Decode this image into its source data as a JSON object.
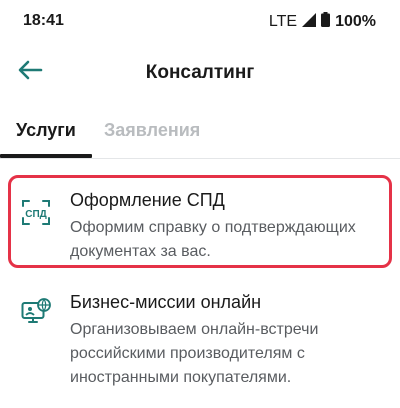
{
  "status_bar": {
    "time": "18:41",
    "network": "LTE",
    "battery": "100%"
  },
  "header": {
    "title": "Консалтинг",
    "back_icon": "arrow-left-icon"
  },
  "tabs": [
    {
      "label": "Услуги",
      "active": true
    },
    {
      "label": "Заявления",
      "active": false
    }
  ],
  "services": [
    {
      "title": "Оформление СПД",
      "description": "Оформим справку о подтверждающих документах за вас.",
      "icon": "spd-document-icon",
      "icon_text": "СПД",
      "highlighted": true
    },
    {
      "title": "Бизнес-миссии онлайн",
      "description": "Организовываем онлайн-встречи российскими производителям с иностранными покупателями.",
      "icon": "online-meeting-globe-icon",
      "highlighted": false
    }
  ],
  "colors": {
    "accent_teal": "#1e7a75",
    "highlight_red": "#e53247",
    "inactive_tab": "#b9bcbf",
    "text_primary": "#1a1a1a",
    "text_secondary": "#595c60"
  }
}
